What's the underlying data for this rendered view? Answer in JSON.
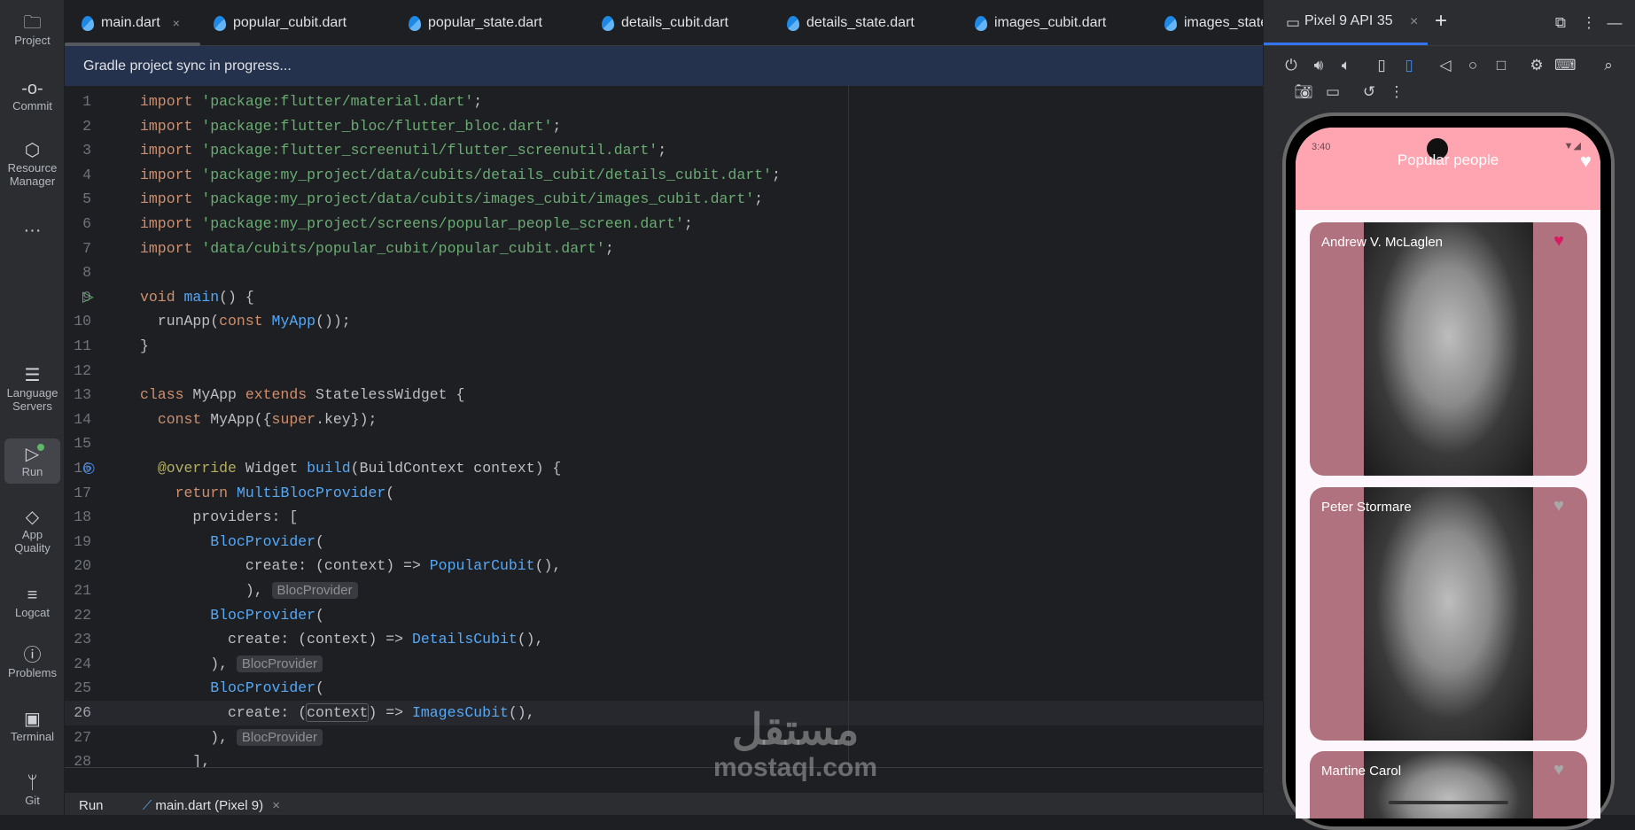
{
  "sidebar": {
    "items": [
      {
        "label": "Project",
        "icon": "folder-icon"
      },
      {
        "label": "Commit",
        "icon": "commit-icon"
      },
      {
        "label": "Resource Manager",
        "icon": "resource-manager-icon"
      },
      {
        "label": "...",
        "icon": "more-icon"
      },
      {
        "label": "Language Servers",
        "icon": "server-icon"
      },
      {
        "label": "Run",
        "icon": "run-icon"
      },
      {
        "label": "App Quality Insights",
        "icon": "diamond-icon"
      },
      {
        "label": "Logcat",
        "icon": "logcat-icon"
      },
      {
        "label": "Problems",
        "icon": "problems-icon"
      },
      {
        "label": "Terminal",
        "icon": "terminal-icon"
      },
      {
        "label": "Git",
        "icon": "git-icon"
      }
    ]
  },
  "tabs": [
    "main.dart",
    "popular_cubit.dart",
    "popular_state.dart",
    "details_cubit.dart",
    "details_state.dart",
    "images_cubit.dart",
    "images_state.dart"
  ],
  "tab_close": "×",
  "banner": "Gradle project sync in progress...",
  "code": [
    [
      [
        "import",
        "kw"
      ],
      [
        " "
      ],
      [
        "'package:flutter/material.dart'",
        "str"
      ],
      [
        ";"
      ]
    ],
    [
      [
        "import",
        "kw"
      ],
      [
        " "
      ],
      [
        "'package:flutter_bloc/flutter_bloc.dart'",
        "str"
      ],
      [
        ";"
      ]
    ],
    [
      [
        "import",
        "kw"
      ],
      [
        " "
      ],
      [
        "'package:flutter_screenutil/flutter_screenutil.dart'",
        "str"
      ],
      [
        ";"
      ]
    ],
    [
      [
        "import",
        "kw"
      ],
      [
        " "
      ],
      [
        "'package:my_project/data/cubits/details_cubit/details_cubit.dart'",
        "str"
      ],
      [
        ";"
      ]
    ],
    [
      [
        "import",
        "kw"
      ],
      [
        " "
      ],
      [
        "'package:my_project/data/cubits/images_cubit/images_cubit.dart'",
        "str"
      ],
      [
        ";"
      ]
    ],
    [
      [
        "import",
        "kw"
      ],
      [
        " "
      ],
      [
        "'package:my_project/screens/popular_people_screen.dart'",
        "str"
      ],
      [
        ";"
      ]
    ],
    [
      [
        "import",
        "kw"
      ],
      [
        " "
      ],
      [
        "'data/cubits/popular_cubit/popular_cubit.dart'",
        "str"
      ],
      [
        ";"
      ]
    ],
    [],
    [
      [
        "void",
        "kw"
      ],
      [
        " "
      ],
      [
        "main",
        "fn"
      ],
      [
        "() {"
      ]
    ],
    [
      [
        "  runApp("
      ],
      [
        "const",
        "kw"
      ],
      [
        " "
      ],
      [
        "MyApp",
        "fn"
      ],
      [
        "());"
      ]
    ],
    [
      [
        "}"
      ]
    ],
    [],
    [
      [
        "class",
        "kw"
      ],
      [
        " MyApp "
      ],
      [
        "extends",
        "kw"
      ],
      [
        " StatelessWidget {"
      ]
    ],
    [
      [
        "  "
      ],
      [
        "const",
        "kw"
      ],
      [
        " MyApp({"
      ],
      [
        "super",
        "kw"
      ],
      [
        ".key});"
      ]
    ],
    [],
    [
      [
        "  "
      ],
      [
        "@override",
        "ann"
      ],
      [
        " Widget "
      ],
      [
        "build",
        "fn"
      ],
      [
        "(BuildContext context) {"
      ]
    ],
    [
      [
        "    "
      ],
      [
        "return",
        "kw"
      ],
      [
        " "
      ],
      [
        "MultiBlocProvider",
        "fn"
      ],
      [
        "("
      ]
    ],
    [
      [
        "      providers: ["
      ]
    ],
    [
      [
        "        "
      ],
      [
        "BlocProvider",
        "fn"
      ],
      [
        "("
      ]
    ],
    [
      [
        "            create: (context) => "
      ],
      [
        "PopularCubit",
        "fn"
      ],
      [
        "(),"
      ]
    ],
    [
      [
        "            ), "
      ],
      [
        "BlocProvider",
        "hint"
      ]
    ],
    [
      [
        "        "
      ],
      [
        "BlocProvider",
        "fn"
      ],
      [
        "("
      ]
    ],
    [
      [
        "          create: (context) => "
      ],
      [
        "DetailsCubit",
        "fn"
      ],
      [
        "(),"
      ]
    ],
    [
      [
        "        ), "
      ],
      [
        "BlocProvider",
        "hint"
      ]
    ],
    [
      [
        "        "
      ],
      [
        "BlocProvider",
        "fn"
      ],
      [
        "("
      ]
    ],
    [
      [
        "          create: ("
      ],
      [
        "context",
        "box"
      ],
      [
        ") => "
      ],
      [
        "ImagesCubit",
        "fn"
      ],
      [
        "(),"
      ]
    ],
    [
      [
        "        ), "
      ],
      [
        "BlocProvider",
        "hint"
      ]
    ],
    [
      [
        "      ],"
      ]
    ]
  ],
  "current_line": 26,
  "run_bar": {
    "label": "Run",
    "config": "main.dart (Pixel 9)",
    "close": "×"
  },
  "device_panel": {
    "tab": "Pixel 9 API 35",
    "close": "×",
    "add": "+"
  },
  "phone": {
    "status_time": "3:40",
    "app_title": "Popular people",
    "people": [
      {
        "name": "Andrew V. McLaglen",
        "favorite": true
      },
      {
        "name": "Peter Stormare",
        "favorite": false
      },
      {
        "name": "Martine Carol",
        "favorite": false
      }
    ]
  },
  "watermark": {
    "arabic": "مستقل",
    "latin": "mostaql.com"
  },
  "colors": {
    "favorite": "#d81b60",
    "not_favorite": "#a8a8a8",
    "card": "#b0727e",
    "appbar": "#ffa4b1"
  }
}
